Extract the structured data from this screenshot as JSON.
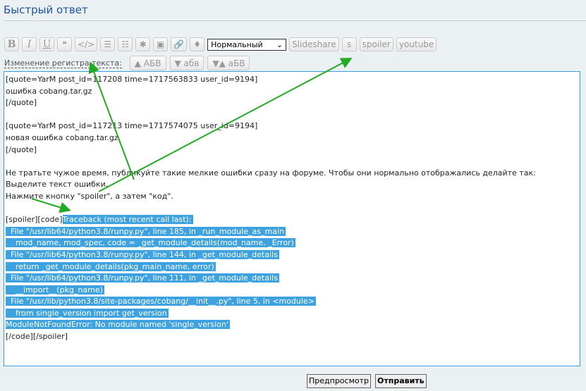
{
  "title": "Быстрый ответ",
  "toolbar": {
    "bold": "B",
    "italic": "I",
    "underline": "U",
    "quote": "❝",
    "code": "</>",
    "list": "☰",
    "olist": "☷",
    "star": "✱",
    "image": "▣",
    "link": "🔗",
    "color": "♦",
    "font_size": "Нормальный",
    "slideshare": "Slideshare",
    "s": "s",
    "spoiler": "spoiler",
    "youtube": "youtube"
  },
  "case": {
    "label": "Изменение регистра текста:",
    "upper": "▲ АБВ",
    "lower": "▼ абв",
    "invert": "▼▲ аБВ"
  },
  "editor": {
    "lines": [
      "[quote=YarM post_id=117208 time=1717563833 user_id=9194]",
      "ошибка cobang.tar.gz",
      "[/quote]",
      "",
      "[quote=YarM post_id=117213 time=1717574075 user_id=9194]",
      "новая ошибка cobang.tar.gz",
      "[/quote]",
      "",
      "Не тратьте чужое время, публикуйте такие мелкие ошибки сразу на форуме. Чтобы они нормально отображались делайте так:",
      "Выделите текст ошибки.",
      "Нажмите кнопку \"spoiler\", а затем \"код\".",
      ""
    ],
    "prefix": "[spoiler][code]",
    "selected": [
      "Traceback (most recent call last):",
      "  File \"/usr/lib64/python3.8/runpy.py\", line 185, in _run_module_as_main",
      "    mod_name, mod_spec, code = _get_module_details(mod_name, _Error)",
      "  File \"/usr/lib64/python3.8/runpy.py\", line 144, in _get_module_details",
      "    return _get_module_details(pkg_main_name, error)",
      "  File \"/usr/lib64/python3.8/runpy.py\", line 111, in _get_module_details",
      "    __import__(pkg_name)",
      "  File \"/usr/lib/python3.8/site-packages/cobang/__init__.py\", line 5, in <module>",
      "    from single_version import get_version",
      "ModuleNotFoundError: No module named 'single_version'"
    ],
    "suffix": "[/code][/spoiler]"
  },
  "buttons": {
    "preview": "Предпросмотр",
    "submit": "Отправить"
  },
  "colors": {
    "arrow": "#22aa22",
    "selection": "#3ea2e0",
    "title": "#1f55a5"
  }
}
